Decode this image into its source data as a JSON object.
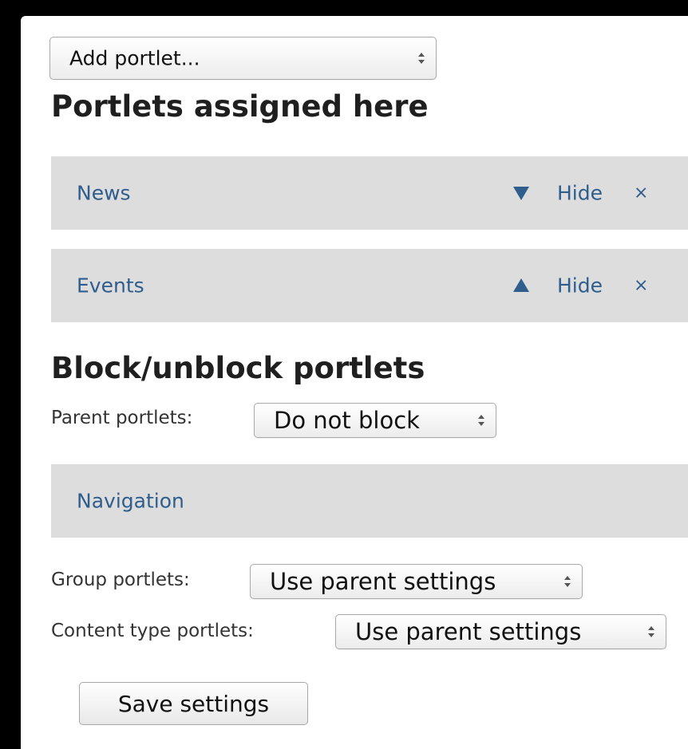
{
  "add_portlet": {
    "selected": "Add portlet..."
  },
  "assigned": {
    "heading": "Portlets assigned here",
    "items": [
      {
        "name": "News",
        "move_icon": "triangle-down-icon",
        "hide": "Hide",
        "remove": "×"
      },
      {
        "name": "Events",
        "move_icon": "triangle-up-icon",
        "hide": "Hide",
        "remove": "×"
      }
    ]
  },
  "block": {
    "heading": "Block/unblock portlets",
    "parent": {
      "label": "Parent portlets:",
      "selected": "Do not block"
    },
    "inherited_items": [
      {
        "name": "Navigation"
      }
    ],
    "group": {
      "label": "Group portlets:",
      "selected": "Use parent settings"
    },
    "content_type": {
      "label": "Content type portlets:",
      "selected": "Use parent settings"
    }
  },
  "save_button": "Save settings",
  "colors": {
    "link": "#2f5d8c",
    "bar_background": "#dddddd",
    "frame": "#000000"
  }
}
